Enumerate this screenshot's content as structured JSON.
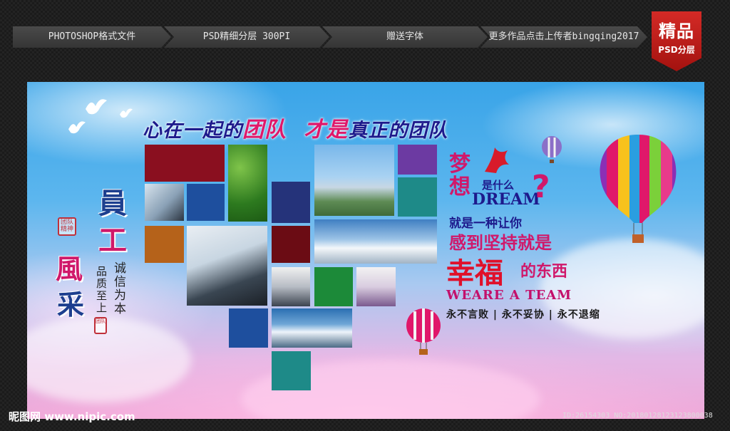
{
  "topbar": {
    "seg1": "PHOTOSHOP格式文件",
    "seg2": "PSD精细分层 300PI",
    "seg3": "赠送字体",
    "seg4": "更多作品点击上传者bingqing2017"
  },
  "badge": {
    "line1": "精品",
    "line2": "PSD分层"
  },
  "poster": {
    "headline_a": "心在一起的",
    "headline_b": "团队",
    "headline_c": "才是",
    "headline_d": "真正的团队",
    "left_big_1": "員",
    "left_big_2": "工",
    "left_big_3": "風",
    "left_big_4": "采",
    "left_vertical_1": "诚信为本",
    "left_vertical_2": "品质至上",
    "seal_top": "团队精神",
    "seal_bottom": "团队",
    "dream_1": "梦",
    "dream_2": "想",
    "dream_3": "是什么",
    "dream_4": "DREAM",
    "dream_5": "?",
    "dream_6": "就是一种让你",
    "dream_7": "感到坚持就是",
    "dream_8": "幸福",
    "dream_9": "的东西",
    "team": "WEARE A TEAM",
    "slogan": "永不言败 | 永不妥协 | 永不退缩"
  },
  "footer": {
    "left": "昵图网 www.nipic.com",
    "right": "ID:26154303 NO:20180128123123800038"
  },
  "colors": {
    "square_red": "#8a0f1f",
    "square_blue": "#1e4f9e",
    "square_navy": "#25337a",
    "square_orange": "#b5621a",
    "square_maroon": "#6b0c14",
    "square_teal": "#1e8a88",
    "square_purple": "#6c3aa2",
    "square_green": "#1c8a39",
    "headline_blue": "#1d1a8c",
    "accent_pink": "#e0186a"
  }
}
